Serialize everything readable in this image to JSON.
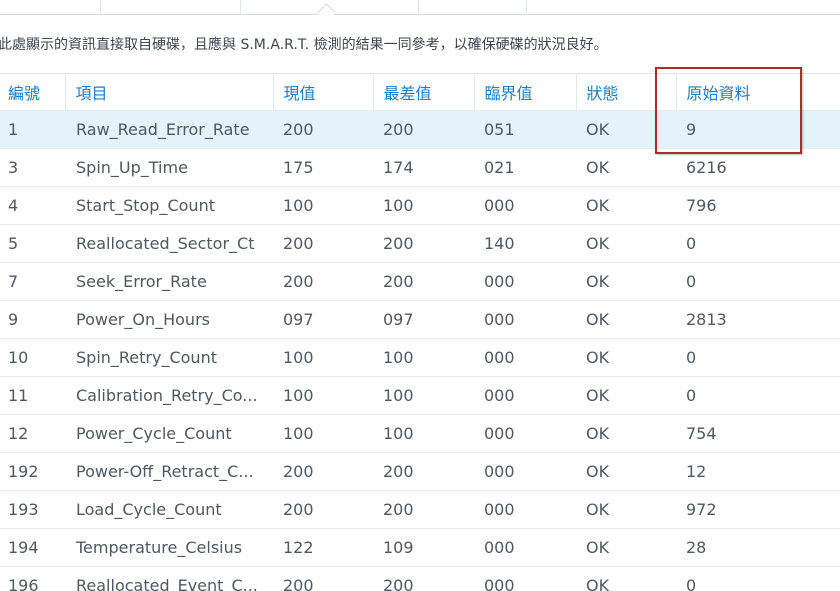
{
  "description": "此處顯示的資訊直接取自硬碟，且應與 S.M.A.R.T. 檢測的結果一同參考，以確保硬碟的狀況良好。",
  "columns": {
    "id": "編號",
    "attribute": "項目",
    "current": "現值",
    "worst": "最差值",
    "threshold": "臨界值",
    "status": "狀態",
    "raw": "原始資料"
  },
  "rows": [
    {
      "id": "1",
      "attribute": "Raw_Read_Error_Rate",
      "current": "200",
      "worst": "200",
      "threshold": "051",
      "status": "OK",
      "raw": "9"
    },
    {
      "id": "3",
      "attribute": "Spin_Up_Time",
      "current": "175",
      "worst": "174",
      "threshold": "021",
      "status": "OK",
      "raw": "6216"
    },
    {
      "id": "4",
      "attribute": "Start_Stop_Count",
      "current": "100",
      "worst": "100",
      "threshold": "000",
      "status": "OK",
      "raw": "796"
    },
    {
      "id": "5",
      "attribute": "Reallocated_Sector_Ct",
      "current": "200",
      "worst": "200",
      "threshold": "140",
      "status": "OK",
      "raw": "0"
    },
    {
      "id": "7",
      "attribute": "Seek_Error_Rate",
      "current": "200",
      "worst": "200",
      "threshold": "000",
      "status": "OK",
      "raw": "0"
    },
    {
      "id": "9",
      "attribute": "Power_On_Hours",
      "current": "097",
      "worst": "097",
      "threshold": "000",
      "status": "OK",
      "raw": "2813"
    },
    {
      "id": "10",
      "attribute": "Spin_Retry_Count",
      "current": "100",
      "worst": "100",
      "threshold": "000",
      "status": "OK",
      "raw": "0"
    },
    {
      "id": "11",
      "attribute": "Calibration_Retry_Co...",
      "current": "100",
      "worst": "100",
      "threshold": "000",
      "status": "OK",
      "raw": "0"
    },
    {
      "id": "12",
      "attribute": "Power_Cycle_Count",
      "current": "100",
      "worst": "100",
      "threshold": "000",
      "status": "OK",
      "raw": "754"
    },
    {
      "id": "192",
      "attribute": "Power-Off_Retract_C...",
      "current": "200",
      "worst": "200",
      "threshold": "000",
      "status": "OK",
      "raw": "12"
    },
    {
      "id": "193",
      "attribute": "Load_Cycle_Count",
      "current": "200",
      "worst": "200",
      "threshold": "000",
      "status": "OK",
      "raw": "972"
    },
    {
      "id": "194",
      "attribute": "Temperature_Celsius",
      "current": "122",
      "worst": "109",
      "threshold": "000",
      "status": "OK",
      "raw": "28"
    },
    {
      "id": "196",
      "attribute": "Reallocated_Event_C...",
      "current": "200",
      "worst": "200",
      "threshold": "000",
      "status": "OK",
      "raw": "0"
    }
  ],
  "colors": {
    "header_text": "#1f7ec1",
    "selected_row": "#e6f2fb",
    "highlight_box": "#b02a2a"
  }
}
